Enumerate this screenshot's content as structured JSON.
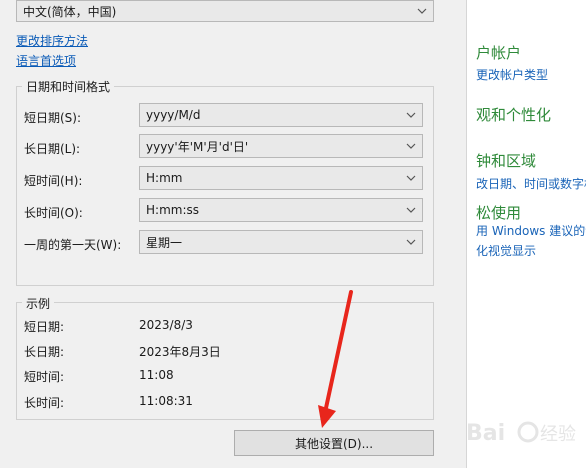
{
  "language_dropdown": {
    "value": "中文(简体，中国)"
  },
  "links": {
    "change_sort": "更改排序方法",
    "language_prefs": "语言首选项"
  },
  "datetime_group": {
    "title": "日期和时间格式",
    "rows": [
      {
        "label": "短日期(S):",
        "value": "yyyy/M/d"
      },
      {
        "label": "长日期(L):",
        "value": "yyyy'年'M'月'd'日'"
      },
      {
        "label": "短时间(H):",
        "value": "H:mm"
      },
      {
        "label": "长时间(O):",
        "value": "H:mm:ss"
      },
      {
        "label": "一周的第一天(W):",
        "value": "星期一"
      }
    ]
  },
  "example_group": {
    "title": "示例",
    "rows": [
      {
        "label": "短日期:",
        "value": "2023/8/3"
      },
      {
        "label": "长日期:",
        "value": "2023年8月3日"
      },
      {
        "label": "短时间:",
        "value": "11:08"
      },
      {
        "label": "长时间:",
        "value": "11:08:31"
      }
    ]
  },
  "buttons": {
    "other_settings": "其他设置(D)..."
  },
  "control_panel": {
    "user_accounts_heading": "户帐户",
    "user_accounts_link": "更改帐户类型",
    "appearance_heading": "观和个性化",
    "clock_region_heading": "钟和区域",
    "clock_region_link": "改日期、时间或数字格",
    "ease_heading": "松使用",
    "ease_link1": "用 Windows 建议的设",
    "ease_link2": "化视觉显示"
  },
  "colors": {
    "dialog_bg": "#f0f0f0",
    "link": "#0b5bb7",
    "cp_heading": "#2f8a3a",
    "arrow": "#e8261c"
  },
  "watermark": {
    "brand": "Baidu"
  }
}
